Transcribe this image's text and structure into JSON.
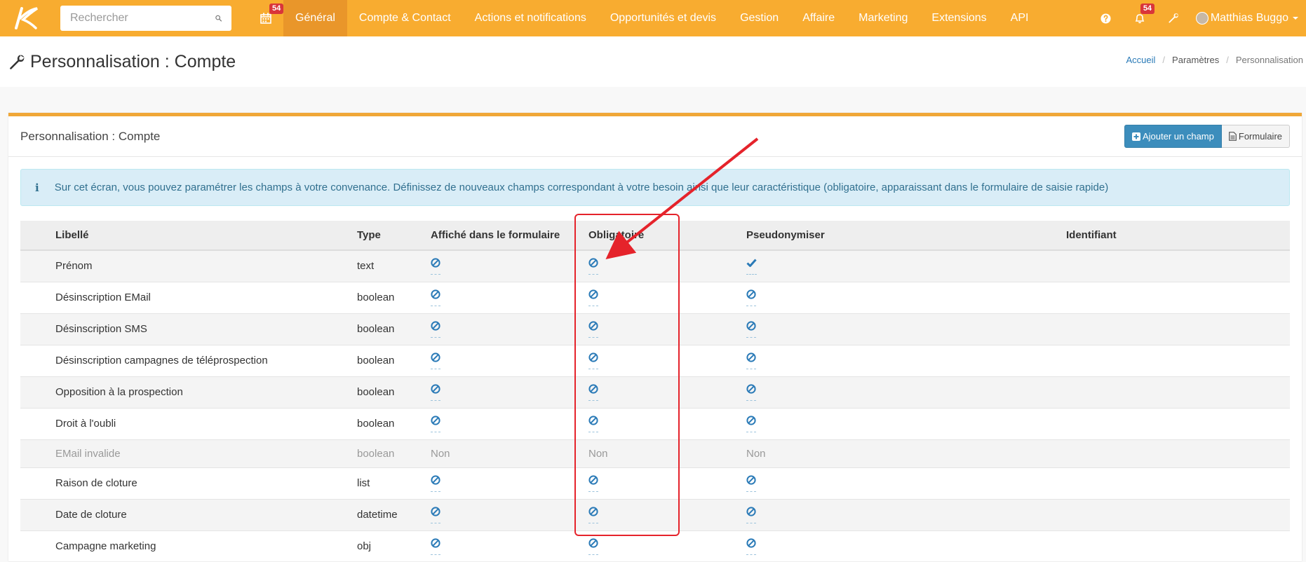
{
  "search": {
    "placeholder": "Rechercher"
  },
  "calendar": {
    "badge": "54"
  },
  "nav": [
    {
      "label": "Général"
    },
    {
      "label": "Compte & Contact"
    },
    {
      "label": "Actions et notifications"
    },
    {
      "label": "Opportunités et devis"
    },
    {
      "label": "Gestion"
    },
    {
      "label": "Affaire"
    },
    {
      "label": "Marketing"
    },
    {
      "label": "Extensions"
    },
    {
      "label": "API"
    }
  ],
  "notifications": {
    "badge": "54"
  },
  "user": {
    "name": "Matthias Buggo"
  },
  "page": {
    "title": "Personnalisation : Compte"
  },
  "breadcrumb": {
    "home": "Accueil",
    "settings": "Paramètres",
    "current": "Personnalisation"
  },
  "panel": {
    "title": "Personnalisation : Compte",
    "add_button": "Ajouter un champ",
    "form_button": "Formulaire"
  },
  "info": "Sur cet écran, vous pouvez paramétrer les champs à votre convenance. Définissez de nouveaux champs correspondant à votre besoin ainsi que leur caractéristique (obligatoire, apparaissant dans le formulaire de saisie rapide)",
  "table": {
    "headers": {
      "label": "Libellé",
      "type": "Type",
      "shown": "Affiché dans le formulaire",
      "required": "Obligatoire",
      "pseudo": "Pseudonymiser",
      "identifier": "Identifiant"
    },
    "rows": [
      {
        "label": "Prénom",
        "type": "text",
        "shown": "ban",
        "required": "ban",
        "pseudo": "check"
      },
      {
        "label": "Désinscription EMail",
        "type": "boolean",
        "shown": "ban",
        "required": "ban",
        "pseudo": "ban"
      },
      {
        "label": "Désinscription SMS",
        "type": "boolean",
        "shown": "ban",
        "required": "ban",
        "pseudo": "ban"
      },
      {
        "label": "Désinscription campagnes de téléprospection",
        "type": "boolean",
        "shown": "ban",
        "required": "ban",
        "pseudo": "ban"
      },
      {
        "label": "Opposition à la prospection",
        "type": "boolean",
        "shown": "ban",
        "required": "ban",
        "pseudo": "ban"
      },
      {
        "label": "Droit à l'oubli",
        "type": "boolean",
        "shown": "ban",
        "required": "ban",
        "pseudo": "ban"
      },
      {
        "label": "EMail invalide",
        "type": "boolean",
        "shown": "Non",
        "required": "Non",
        "pseudo": "Non",
        "muted": true
      },
      {
        "label": "Raison de cloture",
        "type": "list",
        "shown": "ban",
        "required": "ban",
        "pseudo": "ban"
      },
      {
        "label": "Date de cloture",
        "type": "datetime",
        "shown": "ban",
        "required": "ban",
        "pseudo": "ban"
      },
      {
        "label": "Campagne marketing",
        "type": "obj",
        "shown": "ban",
        "required": "ban",
        "pseudo": "ban"
      }
    ]
  },
  "colors": {
    "topbar": "#f8ac30",
    "active_nav": "#e9962a",
    "accent_blue": "#3c8dbc",
    "annotation_red": "#e5232b",
    "icon_blue": "#2a7ab7"
  }
}
